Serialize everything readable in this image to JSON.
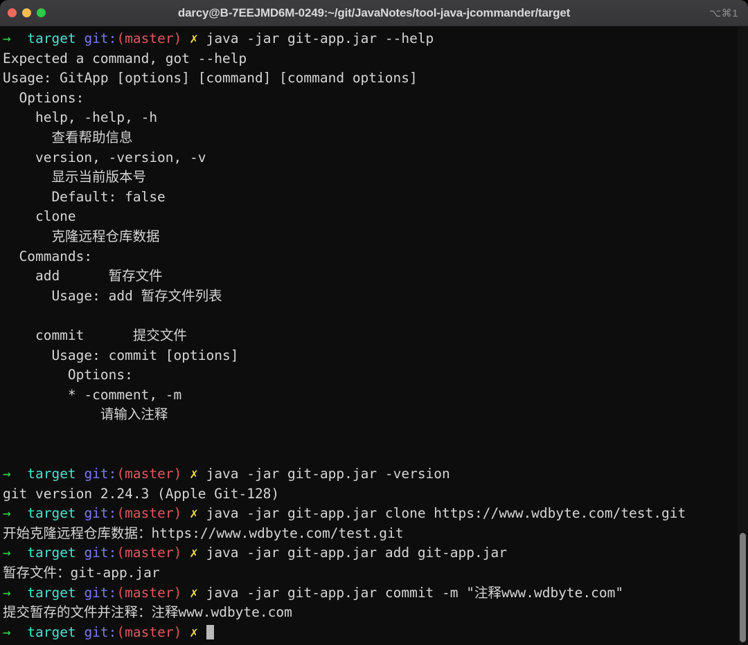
{
  "window": {
    "title": "darcy@B-7EEJMD6M-0249:~/git/JavaNotes/tool-java-jcommander/target",
    "shortcut": "⌥⌘1",
    "buttons": {
      "close": "close-button",
      "minimize": "minimize-button",
      "maximize": "maximize-button"
    }
  },
  "prompt": {
    "arrow": "→",
    "dir": "target",
    "git_label": "git:",
    "branch": "(master)",
    "status": "✗"
  },
  "colors": {
    "titlebar_bg": "#3a3a3c",
    "terminal_bg": "#0d0d0d",
    "text": "#d6d6d6",
    "arrow_green": "#3ad14f",
    "dir_cyan": "#4ae0d0",
    "git_blue": "#7b79e8",
    "branch_red": "#e0555f",
    "status_yellow": "#ecd94a",
    "close_red": "#ed6a5e",
    "minimize_yellow": "#f5bd4f",
    "maximize_green": "#2ec84a",
    "scrollbar_thumb": "#7d7d7d",
    "cursor": "#b9b9b9"
  },
  "lines": [
    {
      "type": "prompt",
      "command": "java -jar git-app.jar --help"
    },
    {
      "type": "output",
      "text": "Expected a command, got --help"
    },
    {
      "type": "output",
      "text": "Usage: GitApp [options] [command] [command options]"
    },
    {
      "type": "output",
      "text": "  Options:"
    },
    {
      "type": "output",
      "text": "    help, -help, -h"
    },
    {
      "type": "output",
      "text": "      查看帮助信息"
    },
    {
      "type": "output",
      "text": "    version, -version, -v"
    },
    {
      "type": "output",
      "text": "      显示当前版本号"
    },
    {
      "type": "output",
      "text": "      Default: false"
    },
    {
      "type": "output",
      "text": "    clone"
    },
    {
      "type": "output",
      "text": "      克隆远程仓库数据"
    },
    {
      "type": "output",
      "text": "  Commands:"
    },
    {
      "type": "output",
      "text": "    add      暂存文件"
    },
    {
      "type": "output",
      "text": "      Usage: add 暂存文件列表"
    },
    {
      "type": "output",
      "text": ""
    },
    {
      "type": "output",
      "text": "    commit      提交文件"
    },
    {
      "type": "output",
      "text": "      Usage: commit [options]"
    },
    {
      "type": "output",
      "text": "        Options:"
    },
    {
      "type": "output",
      "text": "        * -comment, -m"
    },
    {
      "type": "output",
      "text": "            请输入注释"
    },
    {
      "type": "output",
      "text": ""
    },
    {
      "type": "output",
      "text": ""
    },
    {
      "type": "prompt",
      "command": "java -jar git-app.jar -version"
    },
    {
      "type": "output",
      "text": "git version 2.24.3 (Apple Git-128)"
    },
    {
      "type": "prompt",
      "command": "java -jar git-app.jar clone https://www.wdbyte.com/test.git"
    },
    {
      "type": "output",
      "text": "开始克隆远程仓库数据：https://www.wdbyte.com/test.git"
    },
    {
      "type": "prompt",
      "command": "java -jar git-app.jar add git-app.jar"
    },
    {
      "type": "output",
      "text": "暂存文件：git-app.jar"
    },
    {
      "type": "prompt",
      "command": "java -jar git-app.jar commit -m \"注释www.wdbyte.com\""
    },
    {
      "type": "output",
      "text": "提交暂存的文件并注释：注释www.wdbyte.com"
    },
    {
      "type": "prompt",
      "command": "",
      "cursor": true
    }
  ]
}
